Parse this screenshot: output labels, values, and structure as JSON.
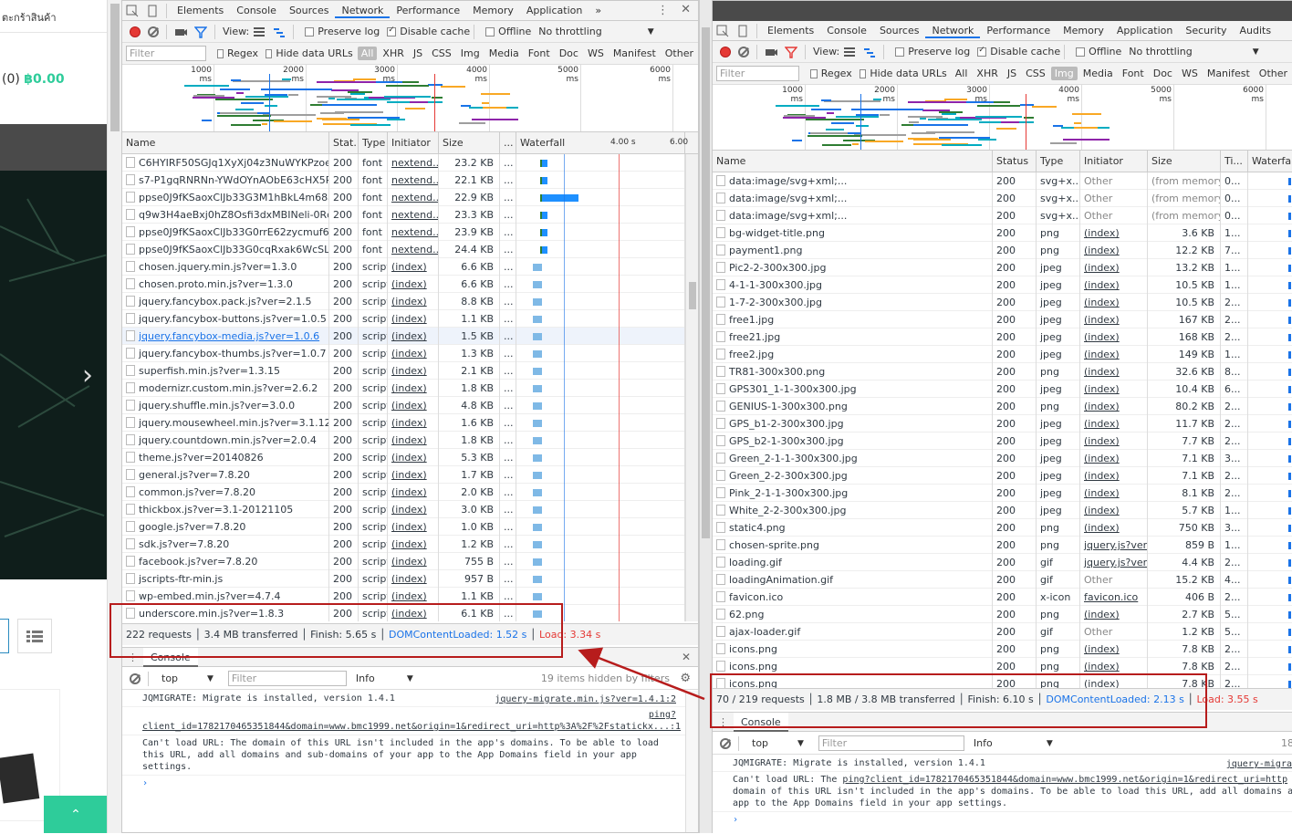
{
  "site": {
    "category": "ตะกร้าสินค้า",
    "cart_summary": "(0) ",
    "cart_total": "฿0.00"
  },
  "left": {
    "tabs": [
      "Elements",
      "Console",
      "Sources",
      "Network",
      "Performance",
      "Memory",
      "Application"
    ],
    "active_tab": "Network",
    "more": "»",
    "view_label": "View:",
    "preserve_log": "Preserve log",
    "disable_cache": "Disable cache",
    "offline": "Offline",
    "throttling": "No throttling",
    "filter_placeholder": "Filter",
    "regex": "Regex",
    "hide_data_urls": "Hide data URLs",
    "type_filters": [
      "All",
      "XHR",
      "JS",
      "CSS",
      "Img",
      "Media",
      "Font",
      "Doc",
      "WS",
      "Manifest",
      "Other"
    ],
    "overview_ticks": [
      "1000 ms",
      "2000 ms",
      "3000 ms",
      "4000 ms",
      "5000 ms",
      "6000 ms"
    ],
    "columns": [
      "Name",
      "Stat...",
      "Type",
      "Initiator",
      "Size",
      "...",
      "Waterfall"
    ],
    "waterfall_ticks": [
      "4.00 s",
      "6.00"
    ],
    "rows": [
      [
        "C6HYIRF50SGJq1XyXj04z3NuWYKPzoeKl...",
        "200",
        "font",
        "nextend...",
        "23.2 KB",
        "..."
      ],
      [
        "s7-P1gqRNRNn-YWdOYnAObE63cHX5P...",
        "200",
        "font",
        "nextend...",
        "22.1 KB",
        "..."
      ],
      [
        "ppse0J9fKSaoxClJb33G3M1hBkL4m68a-...",
        "200",
        "font",
        "nextend...",
        "22.9 KB",
        "..."
      ],
      [
        "q9w3H4aeBxj0hZ8Osfi3dxMBINeli-0RcA...",
        "200",
        "font",
        "nextend...",
        "23.3 KB",
        "..."
      ],
      [
        "ppse0J9fKSaoxClJb33G0rrE62zycmuf6N...",
        "200",
        "font",
        "nextend...",
        "23.9 KB",
        "..."
      ],
      [
        "ppse0J9fKSaoxClJb33G0cqRxak6WcSLU...",
        "200",
        "font",
        "nextend...",
        "24.4 KB",
        "..."
      ],
      [
        "chosen.jquery.min.js?ver=1.3.0",
        "200",
        "script",
        "(index)",
        "6.6 KB",
        "..."
      ],
      [
        "chosen.proto.min.js?ver=1.3.0",
        "200",
        "script",
        "(index)",
        "6.6 KB",
        "..."
      ],
      [
        "jquery.fancybox.pack.js?ver=2.1.5",
        "200",
        "script",
        "(index)",
        "8.8 KB",
        "..."
      ],
      [
        "jquery.fancybox-buttons.js?ver=1.0.5",
        "200",
        "script",
        "(index)",
        "1.1 KB",
        "..."
      ],
      [
        "jquery.fancybox-media.js?ver=1.0.6",
        "200",
        "script",
        "(index)",
        "1.5 KB",
        "..."
      ],
      [
        "jquery.fancybox-thumbs.js?ver=1.0.7",
        "200",
        "script",
        "(index)",
        "1.3 KB",
        "..."
      ],
      [
        "superfish.min.js?ver=1.3.15",
        "200",
        "script",
        "(index)",
        "2.1 KB",
        "..."
      ],
      [
        "modernizr.custom.min.js?ver=2.6.2",
        "200",
        "script",
        "(index)",
        "1.8 KB",
        "..."
      ],
      [
        "jquery.shuffle.min.js?ver=3.0.0",
        "200",
        "script",
        "(index)",
        "4.8 KB",
        "..."
      ],
      [
        "jquery.mousewheel.min.js?ver=3.1.12",
        "200",
        "script",
        "(index)",
        "1.6 KB",
        "..."
      ],
      [
        "jquery.countdown.min.js?ver=2.0.4",
        "200",
        "script",
        "(index)",
        "1.8 KB",
        "..."
      ],
      [
        "theme.js?ver=20140826",
        "200",
        "script",
        "(index)",
        "5.3 KB",
        "..."
      ],
      [
        "general.js?ver=7.8.20",
        "200",
        "script",
        "(index)",
        "1.7 KB",
        "..."
      ],
      [
        "common.js?ver=7.8.20",
        "200",
        "script",
        "(index)",
        "2.0 KB",
        "..."
      ],
      [
        "thickbox.js?ver=3.1-20121105",
        "200",
        "script",
        "(index)",
        "3.0 KB",
        "..."
      ],
      [
        "google.js?ver=7.8.20",
        "200",
        "script",
        "(index)",
        "1.0 KB",
        "..."
      ],
      [
        "sdk.js?ver=7.8.20",
        "200",
        "script",
        "(index)",
        "1.2 KB",
        "..."
      ],
      [
        "facebook.js?ver=7.8.20",
        "200",
        "script",
        "(index)",
        "755 B",
        "..."
      ],
      [
        "jscripts-ftr-min.js",
        "200",
        "script",
        "(index)",
        "957 B",
        "..."
      ],
      [
        "wp-embed.min.js?ver=4.7.4",
        "200",
        "script",
        "(index)",
        "1.1 KB",
        "..."
      ],
      [
        "underscore.min.js?ver=1.8.3",
        "200",
        "script",
        "(index)",
        "6.1 KB",
        "..."
      ]
    ],
    "status_requests": "222 requests",
    "status_transferred": "3.4 MB transferred",
    "status_finish": "Finish: 5.65 s",
    "status_dcl": "DOMContentLoaded: 1.52 s",
    "status_load": "Load: 3.34 s",
    "console_tab": "Console",
    "context": "top",
    "console_filter": "Filter",
    "level": "Info",
    "hidden": "19 items hidden by filters",
    "msg1": "JQMIGRATE: Migrate is installed, version 1.4.1",
    "msg1_src": "jquery-migrate.min.js?ver=1.4.1:2",
    "msg2_link": "ping?client_id=1782170465351844&domain=www.bmc1999.net&origin=1&redirect_uri=http%3A%2F%2Fstatickx...:1",
    "msg2_text": "Can't load URL: The domain of this URL isn't included in the app's domains. To be able to load this URL, add all domains and sub-domains of your app to the App Domains field in your app settings.",
    "prompt": "›"
  },
  "right": {
    "tabs": [
      "Elements",
      "Console",
      "Sources",
      "Network",
      "Performance",
      "Memory",
      "Application",
      "Security",
      "Audits"
    ],
    "active_tab": "Network",
    "view_label": "View:",
    "preserve_log": "Preserve log",
    "disable_cache": "Disable cache",
    "offline": "Offline",
    "throttling": "No throttling",
    "filter_placeholder": "Filter",
    "regex": "Regex",
    "hide_data_urls": "Hide data URLs",
    "type_filters": [
      "All",
      "XHR",
      "JS",
      "CSS",
      "Img",
      "Media",
      "Font",
      "Doc",
      "WS",
      "Manifest",
      "Other"
    ],
    "active_filter": "Img",
    "overview_ticks": [
      "1000 ms",
      "2000 ms",
      "3000 ms",
      "4000 ms",
      "5000 ms",
      "6000 ms"
    ],
    "columns": [
      "Name",
      "Status",
      "Type",
      "Initiator",
      "Size",
      "Ti...",
      "Waterfall"
    ],
    "rows": [
      [
        "data:image/svg+xml;...",
        "200",
        "svg+x...",
        "Other",
        "(from memory...",
        "0..."
      ],
      [
        "data:image/svg+xml;...",
        "200",
        "svg+x...",
        "Other",
        "(from memory...",
        "0..."
      ],
      [
        "data:image/svg+xml;...",
        "200",
        "svg+x...",
        "Other",
        "(from memory...",
        "0..."
      ],
      [
        "bg-widget-title.png",
        "200",
        "png",
        "(index)",
        "3.6 KB",
        "1..."
      ],
      [
        "payment1.png",
        "200",
        "png",
        "(index)",
        "12.2 KB",
        "7..."
      ],
      [
        "Pic2-2-300x300.jpg",
        "200",
        "jpeg",
        "(index)",
        "13.2 KB",
        "1..."
      ],
      [
        "4-1-1-300x300.jpg",
        "200",
        "jpeg",
        "(index)",
        "10.5 KB",
        "1..."
      ],
      [
        "1-7-2-300x300.jpg",
        "200",
        "jpeg",
        "(index)",
        "10.5 KB",
        "2..."
      ],
      [
        "free1.jpg",
        "200",
        "jpeg",
        "(index)",
        "167 KB",
        "2..."
      ],
      [
        "free21.jpg",
        "200",
        "jpeg",
        "(index)",
        "168 KB",
        "2..."
      ],
      [
        "free2.jpg",
        "200",
        "jpeg",
        "(index)",
        "149 KB",
        "1..."
      ],
      [
        "TR81-300x300.png",
        "200",
        "png",
        "(index)",
        "32.6 KB",
        "8..."
      ],
      [
        "GPS301_1-1-300x300.jpg",
        "200",
        "jpeg",
        "(index)",
        "10.4 KB",
        "6..."
      ],
      [
        "GENIUS-1-300x300.png",
        "200",
        "png",
        "(index)",
        "80.2 KB",
        "2..."
      ],
      [
        "GPS_b1-2-300x300.jpg",
        "200",
        "jpeg",
        "(index)",
        "11.7 KB",
        "2..."
      ],
      [
        "GPS_b2-1-300x300.jpg",
        "200",
        "jpeg",
        "(index)",
        "7.7 KB",
        "2..."
      ],
      [
        "Green_2-1-1-300x300.jpg",
        "200",
        "jpeg",
        "(index)",
        "7.1 KB",
        "3..."
      ],
      [
        "Green_2-2-300x300.jpg",
        "200",
        "jpeg",
        "(index)",
        "7.1 KB",
        "2..."
      ],
      [
        "Pink_2-1-1-300x300.jpg",
        "200",
        "jpeg",
        "(index)",
        "8.1 KB",
        "2..."
      ],
      [
        "White_2-2-300x300.jpg",
        "200",
        "jpeg",
        "(index)",
        "5.7 KB",
        "1..."
      ],
      [
        "static4.png",
        "200",
        "png",
        "(index)",
        "750 KB",
        "3..."
      ],
      [
        "chosen-sprite.png",
        "200",
        "png",
        "jquery.js?ver...",
        "859 B",
        "1..."
      ],
      [
        "loading.gif",
        "200",
        "gif",
        "jquery.js?ver...",
        "4.4 KB",
        "2..."
      ],
      [
        "loadingAnimation.gif",
        "200",
        "gif",
        "Other",
        "15.2 KB",
        "4..."
      ],
      [
        "favicon.ico",
        "200",
        "x-icon",
        "favicon.ico",
        "406 B",
        "2..."
      ],
      [
        "62.png",
        "200",
        "png",
        "(index)",
        "2.7 KB",
        "5..."
      ],
      [
        "ajax-loader.gif",
        "200",
        "gif",
        "Other",
        "1.2 KB",
        "5..."
      ],
      [
        "icons.png",
        "200",
        "png",
        "(index)",
        "7.8 KB",
        "2..."
      ],
      [
        "icons.png",
        "200",
        "png",
        "(index)",
        "7.8 KB",
        "2..."
      ],
      [
        "icons.png",
        "200",
        "png",
        "(index)",
        "7.8 KB",
        "2..."
      ]
    ],
    "status_requests": "70 / 219 requests",
    "status_transferred": "1.8 MB / 3.8 MB transferred",
    "status_finish": "Finish: 6.10 s",
    "status_dcl": "DOMContentLoaded: 2.13 s",
    "status_load": "Load: 3.55 s",
    "console_tab": "Console",
    "context": "top",
    "console_filter": "Filter",
    "level": "Info",
    "hidden_count": "18",
    "msg1": "JQMIGRATE: Migrate is installed, version 1.4.1",
    "msg1_src": "jquery-migra",
    "msg2_link": "ping?client_id=1782170465351844&domain=www.bmc1999.net&origin=1&redirect_uri=http",
    "msg2_text1": "Can't load URL: The ",
    "msg2_text2": "domain of this URL isn't included in the app's domains. To be able to load this URL, add all domains and",
    "msg2_text3": "app to the App Domains field in your app settings.",
    "prompt": "›"
  },
  "colors": {
    "accent": "#1a73e8",
    "record": "#e53935",
    "highlight_box": "#b71c1c",
    "cart_total": "#2ecc9a"
  }
}
